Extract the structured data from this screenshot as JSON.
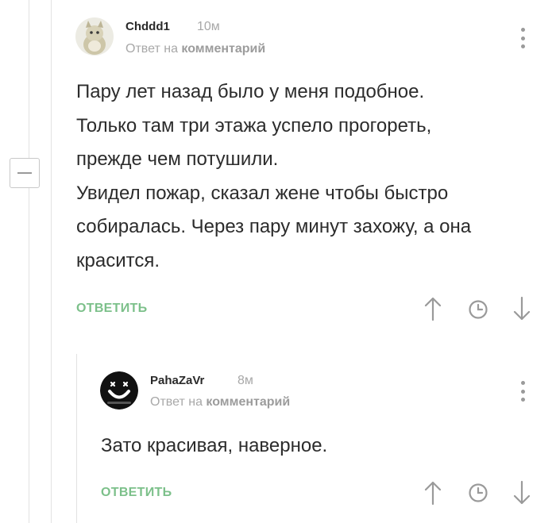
{
  "comments": [
    {
      "author": "Chddd1",
      "time": "10м",
      "reply_prefix": "Ответ на",
      "reply_target": "комментарий",
      "lines": [
        "Пару лет назад было у меня подобное.",
        "Только там три этажа успело прогореть,",
        "прежде чем потушили.",
        "Увидел пожар, сказал жене чтобы быстро",
        "собиралась. Через пару минут захожу, а она",
        "красится."
      ],
      "reply_label": "ОТВЕТИТЬ",
      "icons": [
        "upvote-arrow-icon",
        "clock-icon",
        "downvote-arrow-icon",
        "more-vertical-icon"
      ]
    },
    {
      "author": "PahaZaVr",
      "time": "8м",
      "reply_prefix": "Ответ на",
      "reply_target": "комментарий",
      "lines": [
        "Зато красивая, наверное."
      ],
      "reply_label": "ОТВЕТИТЬ",
      "icons": [
        "upvote-arrow-icon",
        "clock-icon",
        "downvote-arrow-icon",
        "more-vertical-icon"
      ]
    }
  ],
  "colors": {
    "text": "#2c2c2c",
    "meta": "#a8a8a8",
    "reply_button": "#7cc08a",
    "icons": "#9a9a9a",
    "thread_line": "#e2e2e2"
  }
}
